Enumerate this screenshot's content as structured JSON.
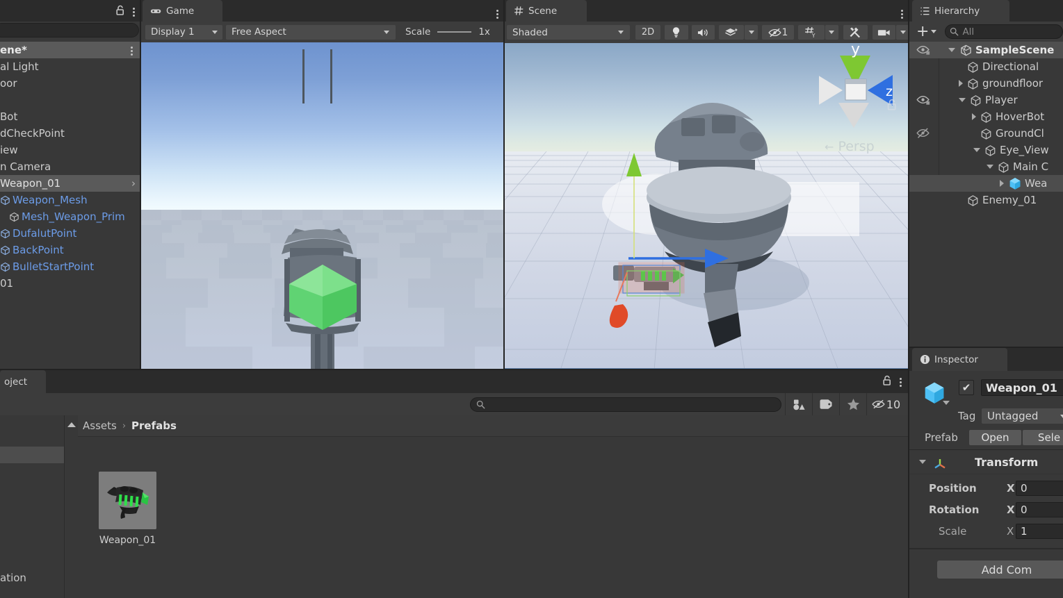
{
  "left_panel": {
    "tab_label": "",
    "lock_icon": "lock-icon",
    "menu_icon": "kebab-menu-icon",
    "search_placeholder": "",
    "rows": [
      {
        "label": "ene*",
        "style": "selected-bold",
        "kebab": true
      },
      {
        "label": "al Light",
        "style": "plain"
      },
      {
        "label": "oor",
        "style": "plain"
      },
      {
        "label": "",
        "style": "plain"
      },
      {
        "label": "Bot",
        "style": "plain"
      },
      {
        "label": "dCheckPoint",
        "style": "plain"
      },
      {
        "label": "iew",
        "style": "plain"
      },
      {
        "label": "n Camera",
        "style": "plain"
      },
      {
        "label": "Weapon_01",
        "style": "selected-arrow"
      },
      {
        "label": "Weapon_Mesh",
        "style": "blue-cube"
      },
      {
        "label": "Mesh_Weapon_Prim",
        "style": "blue-cube-indent"
      },
      {
        "label": "DufalutPoint",
        "style": "blue-cube"
      },
      {
        "label": "BackPoint",
        "style": "blue-cube"
      },
      {
        "label": "BulletStartPoint",
        "style": "blue-cube"
      },
      {
        "label": "01",
        "style": "plain"
      }
    ]
  },
  "game_panel": {
    "tab_label": "Game",
    "tab_icon": "gamepad-icon",
    "menu_icon": "kebab-menu-icon",
    "display_dropdown": "Display 1",
    "aspect_dropdown": "Free Aspect",
    "scale_label": "Scale",
    "scale_value": "1x"
  },
  "scene_panel": {
    "tab_label": "Scene",
    "tab_icon": "grid-hash-icon",
    "menu_icon": "kebab-menu-icon",
    "shading_dropdown": "Shaded",
    "mode_2d_label": "2D",
    "lighting_icon": "lightbulb-icon",
    "audio_icon": "speaker-icon",
    "fx_icon": "effects-icon",
    "visibility_icon": "hidden-eye-icon",
    "visibility_count": "1",
    "grid_icon": "grid-axis-icon",
    "tools_icon": "tools-icon",
    "camera_icon": "camera-icon",
    "gizmo": {
      "axis_y": "y",
      "axis_z": "z",
      "lock_icon": "gizmo-lock-icon",
      "projection_label": "Persp"
    }
  },
  "hierarchy": {
    "tab_label": "Hierarchy",
    "tab_icon": "hierarchy-list-icon",
    "add_icon": "plus-icon",
    "search_placeholder": "All",
    "search_icon": "search-icon",
    "rows": [
      {
        "label": "SampleScene",
        "depth": 0,
        "icon": "unity-scene-icon",
        "expanded": true,
        "bold": true,
        "eye": "visible",
        "selected": false
      },
      {
        "label": "Directional",
        "depth": 2,
        "icon": "cube-icon",
        "expanded": null,
        "bold": false,
        "eye": null,
        "selected": false
      },
      {
        "label": "groundfloor",
        "depth": 1,
        "icon": "cube-icon",
        "expanded": false,
        "bold": false,
        "eye": null,
        "selected": false
      },
      {
        "label": "Player",
        "depth": 1,
        "icon": "cube-icon",
        "expanded": true,
        "bold": false,
        "eye": "visible",
        "selected": false
      },
      {
        "label": "HoverBot",
        "depth": 2,
        "icon": "cube-icon",
        "expanded": false,
        "bold": false,
        "eye": null,
        "selected": false
      },
      {
        "label": "GroundCl",
        "depth": 2,
        "icon": "cube-icon",
        "expanded": null,
        "bold": false,
        "eye": "hidden",
        "selected": false
      },
      {
        "label": "Eye_View",
        "depth": 2,
        "icon": "cube-icon",
        "expanded": true,
        "bold": false,
        "eye": null,
        "selected": false
      },
      {
        "label": "Main C",
        "depth": 3,
        "icon": "cube-icon",
        "expanded": true,
        "bold": false,
        "eye": null,
        "selected": false
      },
      {
        "label": "Wea",
        "depth": 4,
        "icon": "prefab-cube-icon",
        "expanded": false,
        "bold": false,
        "eye": null,
        "selected": true
      },
      {
        "label": "Enemy_01",
        "depth": 1,
        "icon": "cube-icon",
        "expanded": null,
        "bold": false,
        "eye": null,
        "selected": false
      }
    ]
  },
  "inspector": {
    "tab_label": "Inspector",
    "tab_icon": "info-circle-icon",
    "object_icon": "prefab-cube-icon",
    "enabled_checkbox": "✔",
    "object_name": "Weapon_01",
    "tag_label": "Tag",
    "tag_value": "Untagged",
    "prefab_label": "Prefab",
    "prefab_open_button": "Open",
    "prefab_select_button": "Sele",
    "transform": {
      "title": "Transform",
      "icon": "transform-axis-icon",
      "rows": [
        {
          "label": "Position",
          "axis": "X",
          "value": "0"
        },
        {
          "label": "Rotation",
          "axis": "X",
          "value": "0"
        },
        {
          "label": "Scale",
          "axis": "X",
          "value": "1"
        }
      ]
    },
    "add_component_button": "Add Com"
  },
  "project": {
    "tab_label": "oject",
    "lock_icon": "lock-icon",
    "menu_icon": "kebab-menu-icon",
    "search_placeholder": "",
    "search_icon": "search-icon",
    "toolbar_icons": [
      {
        "name": "object-filter-icon"
      },
      {
        "name": "label-tag-icon"
      },
      {
        "name": "favorite-star-icon"
      }
    ],
    "visibility_icon": "hidden-eye-icon",
    "visibility_count": "10",
    "breadcrumb": {
      "root": "Assets",
      "separator": "›",
      "current": "Prefabs"
    },
    "assets": [
      {
        "name": "Weapon_01",
        "icon": "weapon-prefab-thumbnail"
      }
    ],
    "tree_bottom_label": "ation"
  },
  "colors": {
    "panel_bg": "#383838",
    "toolbar_bg": "#3c3c3c",
    "tabstrip_bg": "#2b2b2b",
    "selection": "#4d4d4d",
    "text": "#c8c8c8",
    "prefab_blue": "#6c9ce8",
    "accent_blue": "#5c7ea8",
    "axis_y_green": "#7ec832",
    "axis_z_blue": "#2f6fe0",
    "axis_x_red": "#e04a28"
  }
}
